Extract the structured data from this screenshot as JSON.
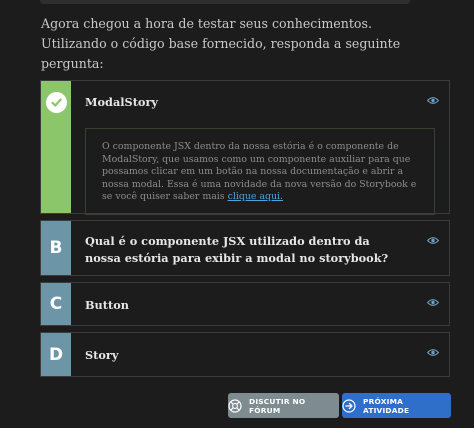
{
  "intro": {
    "text": "Agora chegou a hora de testar seus conhecimentos. Utilizando o código base fornecido, responda a seguinte pergunta:"
  },
  "options": [
    {
      "letter": "",
      "status": "correct",
      "label": "ModalStory",
      "explanation": "O componente JSX dentro da nossa estória é o componente de ModalStory, que usamos como um componente auxiliar para que possamos clicar em um botão na nossa documentação e abrir a nossa modal. Essa é uma novidade da nova versão do Storybook e se você quiser saber mais ",
      "explanation_link": "clique aqui."
    },
    {
      "letter": "B",
      "label": "Qual é o componente JSX utilizado dentro da nossa estória para exibir a modal no storybook?"
    },
    {
      "letter": "C",
      "label": "Button"
    },
    {
      "letter": "D",
      "label": "Story"
    }
  ],
  "actions": {
    "forum_label": "DISCUTIR NO FÓRUM",
    "next_label": "PRÓXIMA ATIVIDADE"
  },
  "colors": {
    "correct": "#8cc66b",
    "option_badge": "#6d95a8",
    "link": "#4aa3df",
    "eye_icon": "#6f9fc0",
    "forum_button": "#7e8b91",
    "next_button": "#2f6fc9"
  }
}
